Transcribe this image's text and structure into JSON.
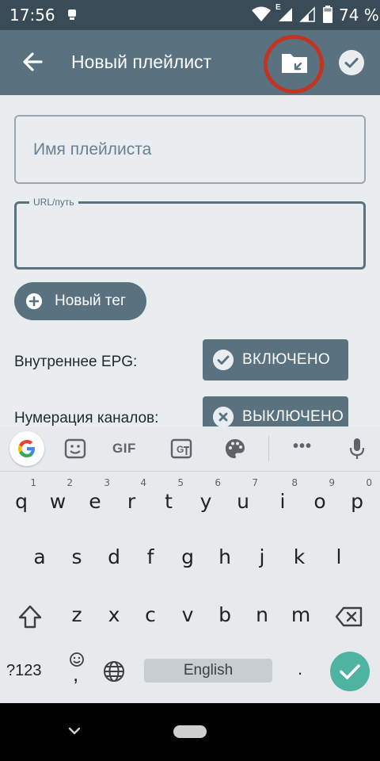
{
  "status_bar": {
    "time": "17:56",
    "network_type": "E",
    "battery": "74 %"
  },
  "app_bar": {
    "title": "Новый плейлист",
    "icons": [
      "arrow-back-icon",
      "folder-open-icon",
      "check-circle-icon"
    ]
  },
  "form": {
    "name_placeholder": "Имя плейлиста",
    "url_label": "URL/путь",
    "url_value": "",
    "new_tag_label": "Новый тег",
    "rows": [
      {
        "label": "Внутреннее EPG:",
        "state": "ВКЛЮЧЕНО",
        "icon": "check-icon"
      },
      {
        "label": "Нумерация каналов:",
        "state": "ВЫКЛЮЧЕНО",
        "icon": "close-icon"
      }
    ]
  },
  "keyboard": {
    "toolbar": {
      "gif_label": "GIF",
      "more_label": "•••",
      "icons": [
        "google-g-icon",
        "sticker-icon",
        "translate-icon",
        "palette-icon",
        "mic-icon"
      ]
    },
    "row1": [
      {
        "key": "q",
        "hint": "1"
      },
      {
        "key": "w",
        "hint": "2"
      },
      {
        "key": "e",
        "hint": "3"
      },
      {
        "key": "r",
        "hint": "4"
      },
      {
        "key": "t",
        "hint": "5"
      },
      {
        "key": "y",
        "hint": "6"
      },
      {
        "key": "u",
        "hint": "7"
      },
      {
        "key": "i",
        "hint": "8"
      },
      {
        "key": "o",
        "hint": "9"
      },
      {
        "key": "p",
        "hint": "0"
      }
    ],
    "row2": [
      "a",
      "s",
      "d",
      "f",
      "g",
      "h",
      "j",
      "k",
      "l"
    ],
    "row3": [
      "z",
      "x",
      "c",
      "v",
      "b",
      "n",
      "m"
    ],
    "symbols_label": "?123",
    "comma_label": ",",
    "space_label": "English",
    "period_label": "."
  },
  "colors": {
    "status_bar": "#394b57",
    "app_bar": "#5a7180",
    "content_bg": "#e9edf0",
    "highlight_circle": "#c23322",
    "enter_key": "#4fb3a1"
  }
}
